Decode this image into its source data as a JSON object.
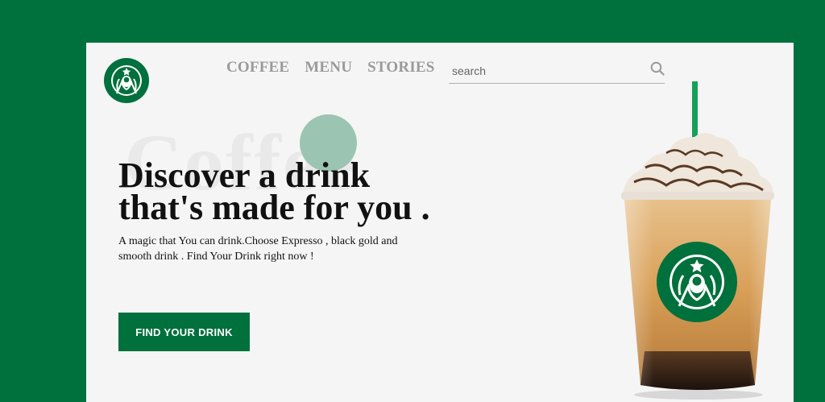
{
  "brand": {
    "logo_icon": "starbucks-siren-logo",
    "primary_color": "#00703c",
    "accent_circle_color": "#9cc4b3"
  },
  "nav": {
    "items": [
      {
        "label": "COFFEE"
      },
      {
        "label": "MENU"
      },
      {
        "label": "STORIES"
      }
    ]
  },
  "search": {
    "placeholder": "search",
    "value": "",
    "icon": "search-icon"
  },
  "hero": {
    "background_word": "Coffee",
    "headline_line1": "Discover a drink",
    "headline_line2": "that's made for you .",
    "description": "A magic that You can drink.Choose Expresso , black gold and smooth drink . Find Your Drink right now !",
    "cta_label": "FIND YOUR DRINK",
    "product_image": "frappuccino-cup"
  }
}
